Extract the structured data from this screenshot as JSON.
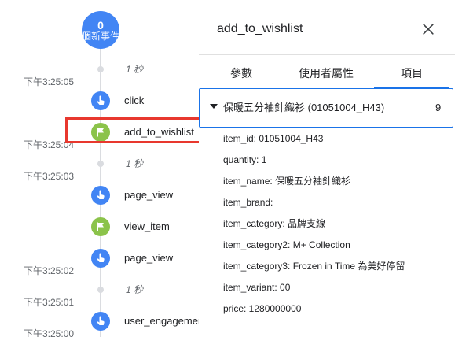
{
  "timeline": {
    "badge": {
      "count": "0",
      "label": "個新事件"
    },
    "gaps": [
      "1 秒",
      "1 秒",
      "1 秒"
    ],
    "timestamps": [
      "下午3:25:05",
      "下午3:25:04",
      "下午3:25:03",
      "下午3:25:02",
      "下午3:25:01",
      "下午3:25:00"
    ],
    "events": [
      {
        "label": "click",
        "icon": "hand-pointer-icon",
        "color": "#4285f4"
      },
      {
        "label": "add_to_wishlist",
        "icon": "flag-icon",
        "color": "#8bc34a"
      },
      {
        "label": "page_view",
        "icon": "hand-pointer-icon",
        "color": "#4285f4"
      },
      {
        "label": "view_item",
        "icon": "flag-icon",
        "color": "#8bc34a"
      },
      {
        "label": "page_view",
        "icon": "hand-pointer-icon",
        "color": "#4285f4"
      },
      {
        "label": "user_engagement",
        "icon": "hand-pointer-icon",
        "color": "#4285f4"
      }
    ],
    "highlight_color": "#e8382e"
  },
  "panel": {
    "title": "add_to_wishlist",
    "tabs": [
      "參數",
      "使用者屬性",
      "項目"
    ],
    "active_tab": "項目",
    "item": {
      "title": "保暖五分袖針織衫 (01051004_H43)",
      "count": "9"
    },
    "params": [
      "item_id: 01051004_H43",
      "quantity: 1",
      "item_name: 保暖五分袖針織衫",
      "item_brand:",
      "item_category: 品牌支線",
      "item_category2: M+ Collection",
      "item_category3: Frozen in Time 為美好停留",
      "item_variant: 00",
      "price: 1280000000"
    ],
    "accent_color": "#1a73e8"
  }
}
